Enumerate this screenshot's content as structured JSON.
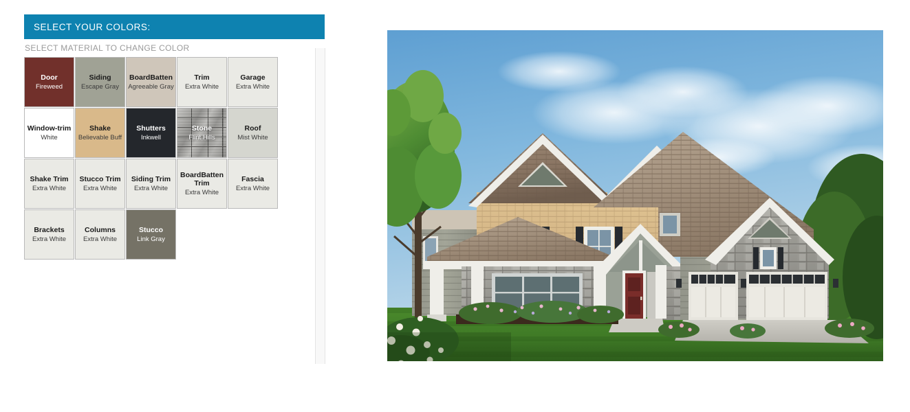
{
  "panel": {
    "header_title": "SELECT YOUR COLORS:",
    "subheader": "SELECT MATERIAL TO CHANGE COLOR",
    "header_bg": "#0e82b0"
  },
  "swatches": [
    [
      {
        "name": "Door",
        "color_name": "Fireweed",
        "hex": "#71302b",
        "text": "dark",
        "texture": "none"
      },
      {
        "name": "Siding",
        "color_name": "Escape Gray",
        "hex": "#a0a295",
        "text": "light",
        "texture": "none"
      },
      {
        "name": "BoardBatten",
        "color_name": "Agreeable Gray",
        "hex": "#cfc6ba",
        "text": "light",
        "texture": "none"
      },
      {
        "name": "Trim",
        "color_name": "Extra White",
        "hex": "#eaeae5",
        "text": "light",
        "texture": "none"
      },
      {
        "name": "Garage",
        "color_name": "Extra White",
        "hex": "#eaeae5",
        "text": "light",
        "texture": "none"
      }
    ],
    [
      {
        "name": "Window-trim",
        "color_name": "White",
        "hex": "#ffffff",
        "text": "light",
        "texture": "none"
      },
      {
        "name": "Shake",
        "color_name": "Believable Buff",
        "hex": "#d9b98a",
        "text": "light",
        "texture": "none"
      },
      {
        "name": "Shutters",
        "color_name": "Inkwell",
        "hex": "#24272c",
        "text": "dark",
        "texture": "none"
      },
      {
        "name": "Stone",
        "color_name": "Flint Hills",
        "hex": "#9b9a95",
        "text": "dark",
        "texture": "stone"
      },
      {
        "name": "Roof",
        "color_name": "Mist White",
        "hex": "#d5d6cf",
        "text": "light",
        "texture": "none"
      }
    ],
    [
      {
        "name": "Shake Trim",
        "color_name": "Extra White",
        "hex": "#eaeae5",
        "text": "light",
        "texture": "none"
      },
      {
        "name": "Stucco Trim",
        "color_name": "Extra White",
        "hex": "#eaeae5",
        "text": "light",
        "texture": "none"
      },
      {
        "name": "Siding Trim",
        "color_name": "Extra White",
        "hex": "#eaeae5",
        "text": "light",
        "texture": "none"
      },
      {
        "name": "BoardBatten Trim",
        "color_name": "Extra White",
        "hex": "#eaeae5",
        "text": "light",
        "texture": "none"
      },
      {
        "name": "Fascia",
        "color_name": "Extra White",
        "hex": "#eaeae5",
        "text": "light",
        "texture": "none"
      }
    ],
    [
      {
        "name": "Brackets",
        "color_name": "Extra White",
        "hex": "#eaeae5",
        "text": "light",
        "texture": "none"
      },
      {
        "name": "Columns",
        "color_name": "Extra White",
        "hex": "#eaeae5",
        "text": "light",
        "texture": "none"
      },
      {
        "name": "Stucco",
        "color_name": "Link Gray",
        "hex": "#757266",
        "text": "dark",
        "texture": "none"
      }
    ]
  ],
  "rendering": {
    "alt": "Two-story home exterior rendering with stone, shake and siding",
    "sky": "#77aedb",
    "lawn": "#3f7a26",
    "roof": "#8d7a68",
    "stone": "#a3a29c",
    "siding": "#a0a295",
    "shake": "#d6bb8a",
    "door": "#7a2d2a",
    "trim": "#efeee9"
  }
}
